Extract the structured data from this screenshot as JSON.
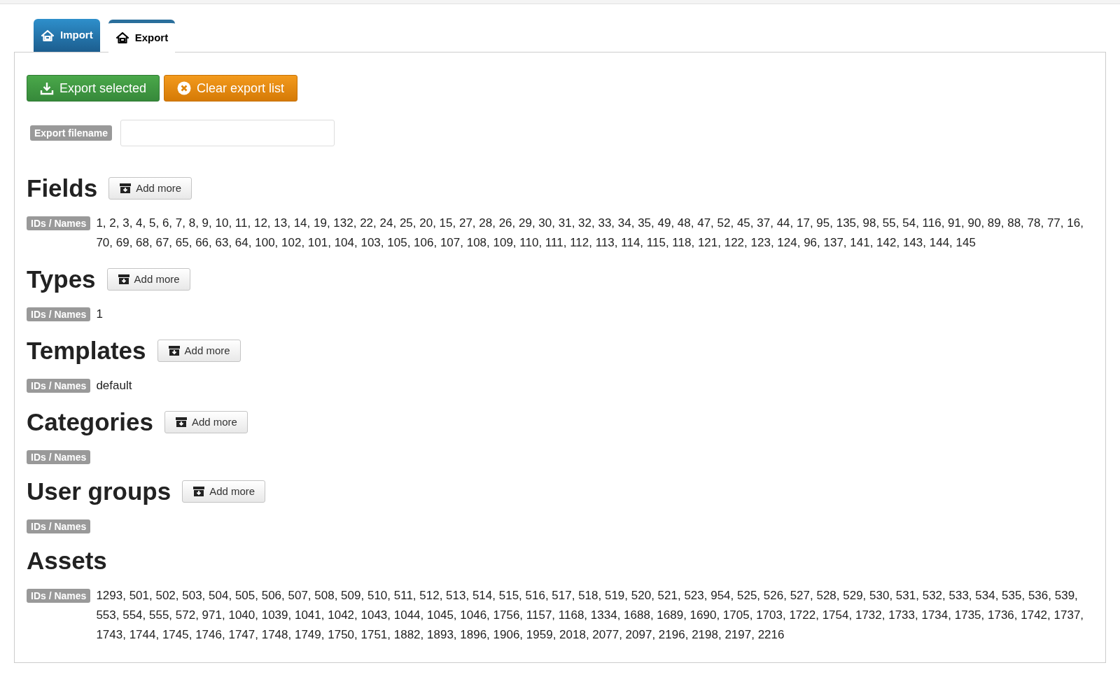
{
  "tabs": [
    {
      "label": "Import",
      "selected": false
    },
    {
      "label": "Export",
      "selected": true
    }
  ],
  "actions": {
    "export_button": "Export selected",
    "clear_button": "Clear export list"
  },
  "filename": {
    "label": "Export filename"
  },
  "sections": [
    {
      "title": "Fields",
      "add_button": "Add more",
      "label": "IDs / Names",
      "value": "1, 2, 3, 4, 5, 6, 7, 8, 9, 10, 11, 12, 13, 14, 19, 132, 22, 24, 25, 20, 15, 27, 28, 26, 29, 30, 31, 32, 33, 34, 35, 49, 48, 47, 52, 45, 37, 44, 17, 95, 135, 98, 55, 54, 116, 91, 90, 89, 88, 78, 77, 16, 70, 69, 68, 67, 65, 66, 63, 64, 100, 102, 101, 104, 103, 105, 106, 107, 108, 109, 110, 111, 112, 113, 114, 115, 118, 121, 122, 123, 124, 96, 137, 141, 142, 143, 144, 145"
    },
    {
      "title": "Types",
      "add_button": "Add more",
      "label": "IDs / Names",
      "value": "1"
    },
    {
      "title": "Templates",
      "add_button": "Add more",
      "label": "IDs / Names",
      "value": "default"
    },
    {
      "title": "Categories",
      "add_button": "Add more",
      "label": "IDs / Names"
    },
    {
      "title": "User groups",
      "add_button": "Add more",
      "label": "IDs / Names"
    },
    {
      "title": "Assets",
      "label": "IDs / Names",
      "value": "1293, 501, 502, 503, 504, 505, 506, 507, 508, 509, 510, 511, 512, 513, 514, 515, 516, 517, 518, 519, 520, 521, 523, 954, 525, 526, 527, 528, 529, 530, 531, 532, 533, 534, 535, 536, 539, 553, 554, 555, 572, 971, 1040, 1039, 1041, 1042, 1043, 1044, 1045, 1046, 1756, 1157, 1168, 1334, 1688, 1689, 1690, 1705, 1703, 1722, 1754, 1732, 1733, 1734, 1735, 1736, 1742, 1737, 1743, 1744, 1745, 1746, 1747, 1748, 1749, 1750, 1751, 1882, 1893, 1896, 1906, 1959, 2018, 2077, 2097, 2196, 2198, 2197, 2216"
    }
  ]
}
